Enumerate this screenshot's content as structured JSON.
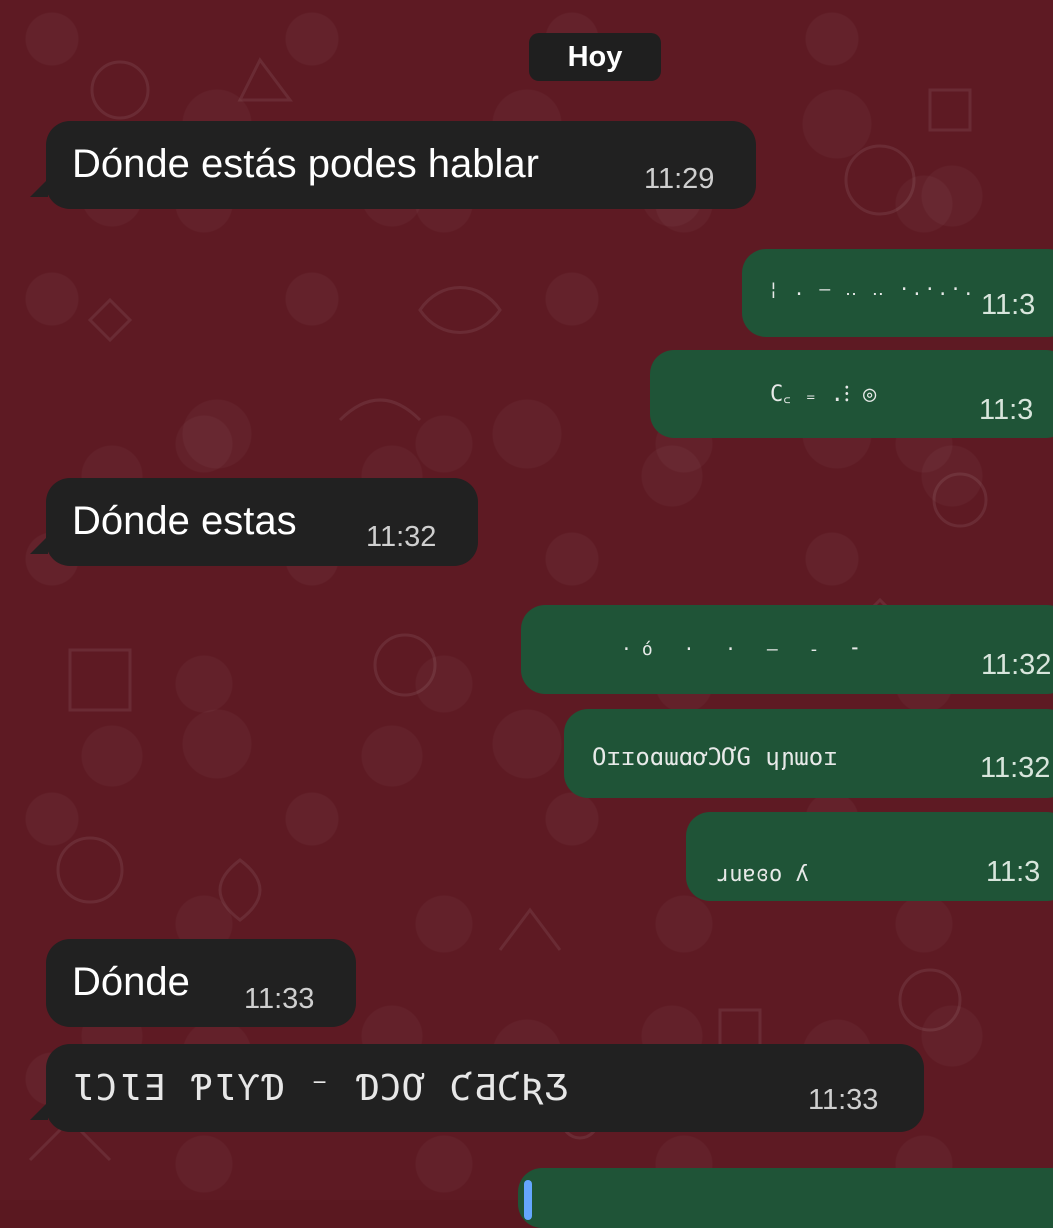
{
  "date_chip": "Hoy",
  "messages": [
    {
      "text": "Dónde estás podes hablar",
      "time": "11:29"
    },
    {
      "text": "",
      "time": "11:3"
    },
    {
      "text": "",
      "time": "11:3"
    },
    {
      "text": "Dónde estas",
      "time": "11:32"
    },
    {
      "text": "",
      "time": "11:32"
    },
    {
      "text": "",
      "time": "11:32"
    },
    {
      "text": "",
      "time": "11:3"
    },
    {
      "text": "Dónde",
      "time": "11:33"
    },
    {
      "text": "",
      "time": "11:33"
    }
  ],
  "colors": {
    "wallpaper": "#5e1a23",
    "incoming": "#212121",
    "outgoing": "#1f5437",
    "accent": "#65a6ff"
  }
}
